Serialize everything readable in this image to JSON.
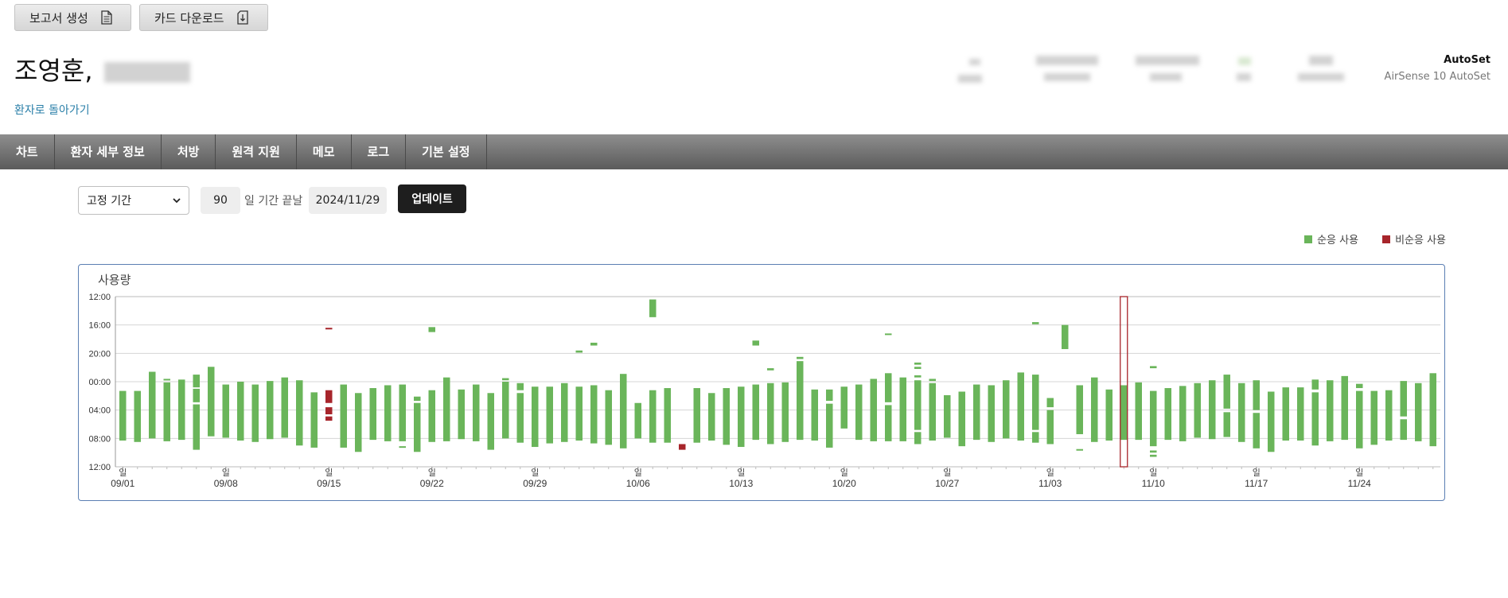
{
  "toolbar": {
    "report_label": "보고서 생성",
    "card_label": "카드 다운로드"
  },
  "patient": {
    "name": "조영훈,"
  },
  "back_link": "환자로 돌아가기",
  "device": {
    "mode": "AutoSet",
    "model": "AirSense 10 AutoSet"
  },
  "nav": {
    "items": [
      "차트",
      "환자 세부 정보",
      "처방",
      "원격 지원",
      "메모",
      "로그",
      "기본 설정"
    ]
  },
  "controls": {
    "period_type": "고정 기간",
    "days": "90",
    "label": "일 기간 끝날",
    "end_date": "2024/11/29",
    "update_label": "업데이트"
  },
  "legend": {
    "compliant": "순응 사용",
    "noncompliant": "비순응 사용"
  },
  "colors": {
    "compliant": "#6ab55a",
    "noncompliant": "#a7252b",
    "highlight": "#a7252b"
  },
  "chart_data": {
    "type": "bar",
    "title": "사용량",
    "y_ticks": [
      "12:00",
      "16:00",
      "20:00",
      "00:00",
      "04:00",
      "08:00",
      "12:00"
    ],
    "y_axis": "hours since 12:00 noon, range [0, 24]",
    "week_label": "일",
    "x_ticks": [
      "09/01",
      "09/08",
      "09/15",
      "09/22",
      "09/29",
      "10/06",
      "10/13",
      "10/20",
      "10/27",
      "11/03",
      "11/10",
      "11/17",
      "11/24"
    ],
    "start_date": "2024-09-01",
    "end_date": "2024-11-29",
    "highlight_date": "2024-11-08",
    "series": [
      {
        "date": "09-01",
        "segments": [
          [
            13.3,
            20.3,
            "c"
          ]
        ]
      },
      {
        "date": "09-02",
        "segments": [
          [
            13.3,
            20.5,
            "c"
          ]
        ]
      },
      {
        "date": "09-03",
        "segments": [
          [
            10.6,
            20.0,
            "c"
          ]
        ]
      },
      {
        "date": "09-04",
        "segments": [
          [
            11.6,
            11.8,
            "c"
          ],
          [
            12.1,
            20.4,
            "c"
          ]
        ]
      },
      {
        "date": "09-05",
        "segments": [
          [
            11.7,
            20.2,
            "c"
          ]
        ]
      },
      {
        "date": "09-06",
        "segments": [
          [
            11.0,
            12.8,
            "c"
          ],
          [
            13.0,
            14.9,
            "c"
          ],
          [
            15.2,
            21.6,
            "c"
          ]
        ]
      },
      {
        "date": "09-07",
        "segments": [
          [
            9.9,
            19.7,
            "c"
          ]
        ]
      },
      {
        "date": "09-08",
        "segments": [
          [
            12.4,
            19.9,
            "c"
          ]
        ]
      },
      {
        "date": "09-09",
        "segments": [
          [
            12.0,
            20.3,
            "c"
          ]
        ]
      },
      {
        "date": "09-10",
        "segments": [
          [
            12.4,
            20.5,
            "c"
          ]
        ]
      },
      {
        "date": "09-11",
        "segments": [
          [
            11.9,
            20.1,
            "c"
          ]
        ]
      },
      {
        "date": "09-12",
        "segments": [
          [
            11.4,
            19.9,
            "c"
          ]
        ]
      },
      {
        "date": "09-13",
        "segments": [
          [
            11.8,
            21.0,
            "c"
          ]
        ]
      },
      {
        "date": "09-14",
        "segments": [
          [
            13.5,
            21.3,
            "c"
          ]
        ]
      },
      {
        "date": "09-15",
        "segments": [
          [
            4.4,
            4.6,
            "n"
          ],
          [
            13.2,
            15.0,
            "n"
          ],
          [
            15.6,
            16.6,
            "n"
          ],
          [
            16.9,
            17.5,
            "n"
          ]
        ]
      },
      {
        "date": "09-16",
        "segments": [
          [
            12.4,
            21.3,
            "c"
          ]
        ]
      },
      {
        "date": "09-17",
        "segments": [
          [
            13.6,
            21.9,
            "c"
          ]
        ]
      },
      {
        "date": "09-18",
        "segments": [
          [
            12.9,
            20.2,
            "c"
          ]
        ]
      },
      {
        "date": "09-19",
        "segments": [
          [
            12.5,
            20.4,
            "c"
          ]
        ]
      },
      {
        "date": "09-20",
        "segments": [
          [
            12.4,
            20.4,
            "c"
          ],
          [
            21.1,
            21.3,
            "c"
          ]
        ]
      },
      {
        "date": "09-21",
        "segments": [
          [
            14.1,
            14.7,
            "c"
          ],
          [
            15.0,
            21.9,
            "c"
          ]
        ]
      },
      {
        "date": "09-22",
        "segments": [
          [
            4.3,
            5.0,
            "c"
          ],
          [
            13.2,
            20.5,
            "c"
          ]
        ]
      },
      {
        "date": "09-23",
        "segments": [
          [
            11.4,
            20.4,
            "c"
          ]
        ]
      },
      {
        "date": "09-24",
        "segments": [
          [
            13.1,
            20.1,
            "c"
          ]
        ]
      },
      {
        "date": "09-25",
        "segments": [
          [
            12.4,
            20.4,
            "c"
          ]
        ]
      },
      {
        "date": "09-26",
        "segments": [
          [
            13.6,
            21.6,
            "c"
          ]
        ]
      },
      {
        "date": "09-27",
        "segments": [
          [
            11.5,
            11.8,
            "c"
          ],
          [
            12.0,
            20.0,
            "c"
          ]
        ]
      },
      {
        "date": "09-28",
        "segments": [
          [
            12.2,
            13.2,
            "c"
          ],
          [
            13.6,
            20.6,
            "c"
          ]
        ]
      },
      {
        "date": "09-29",
        "segments": [
          [
            12.7,
            21.2,
            "c"
          ]
        ]
      },
      {
        "date": "09-30",
        "segments": [
          [
            12.7,
            20.7,
            "c"
          ]
        ]
      },
      {
        "date": "10-01",
        "segments": [
          [
            12.2,
            20.5,
            "c"
          ]
        ]
      },
      {
        "date": "10-02",
        "segments": [
          [
            7.6,
            7.9,
            "c"
          ],
          [
            12.7,
            20.3,
            "c"
          ]
        ]
      },
      {
        "date": "10-03",
        "segments": [
          [
            6.5,
            6.9,
            "c"
          ],
          [
            12.5,
            20.7,
            "c"
          ]
        ]
      },
      {
        "date": "10-04",
        "segments": [
          [
            13.2,
            20.9,
            "c"
          ]
        ]
      },
      {
        "date": "10-05",
        "segments": [
          [
            10.9,
            21.4,
            "c"
          ]
        ]
      },
      {
        "date": "10-06",
        "segments": [
          [
            15.0,
            20.0,
            "c"
          ]
        ]
      },
      {
        "date": "10-07",
        "segments": [
          [
            0.4,
            2.9,
            "c"
          ],
          [
            13.2,
            20.6,
            "c"
          ]
        ]
      },
      {
        "date": "10-08",
        "segments": [
          [
            12.9,
            20.6,
            "c"
          ]
        ]
      },
      {
        "date": "10-09",
        "segments": [
          [
            20.8,
            21.6,
            "n"
          ]
        ]
      },
      {
        "date": "10-10",
        "segments": [
          [
            12.9,
            20.6,
            "c"
          ]
        ]
      },
      {
        "date": "10-11",
        "segments": [
          [
            13.6,
            20.3,
            "c"
          ]
        ]
      },
      {
        "date": "10-12",
        "segments": [
          [
            12.9,
            20.9,
            "c"
          ]
        ]
      },
      {
        "date": "10-13",
        "segments": [
          [
            12.7,
            21.2,
            "c"
          ]
        ]
      },
      {
        "date": "10-14",
        "segments": [
          [
            6.2,
            6.9,
            "c"
          ],
          [
            12.4,
            20.2,
            "c"
          ]
        ]
      },
      {
        "date": "10-15",
        "segments": [
          [
            10.1,
            10.4,
            "c"
          ],
          [
            12.2,
            20.8,
            "c"
          ]
        ]
      },
      {
        "date": "10-16",
        "segments": [
          [
            12.1,
            20.5,
            "c"
          ]
        ]
      },
      {
        "date": "10-17",
        "segments": [
          [
            8.5,
            8.8,
            "c"
          ],
          [
            9.1,
            20.2,
            "c"
          ]
        ]
      },
      {
        "date": "10-18",
        "segments": [
          [
            13.1,
            20.3,
            "c"
          ]
        ]
      },
      {
        "date": "10-19",
        "segments": [
          [
            13.1,
            14.7,
            "c"
          ],
          [
            15.1,
            21.3,
            "c"
          ]
        ]
      },
      {
        "date": "10-20",
        "segments": [
          [
            12.7,
            18.6,
            "c"
          ]
        ]
      },
      {
        "date": "10-21",
        "segments": [
          [
            12.4,
            20.2,
            "c"
          ]
        ]
      },
      {
        "date": "10-22",
        "segments": [
          [
            11.6,
            20.4,
            "c"
          ]
        ]
      },
      {
        "date": "10-23",
        "segments": [
          [
            5.2,
            5.4,
            "c"
          ],
          [
            10.8,
            14.9,
            "c"
          ],
          [
            15.3,
            20.4,
            "c"
          ]
        ]
      },
      {
        "date": "10-24",
        "segments": [
          [
            11.4,
            20.4,
            "c"
          ]
        ]
      },
      {
        "date": "10-25",
        "segments": [
          [
            9.3,
            9.6,
            "c"
          ],
          [
            9.9,
            10.2,
            "c"
          ],
          [
            11.1,
            11.4,
            "c"
          ],
          [
            11.8,
            18.8,
            "c"
          ],
          [
            19.1,
            20.8,
            "c"
          ]
        ]
      },
      {
        "date": "10-26",
        "segments": [
          [
            11.6,
            11.9,
            "c"
          ],
          [
            12.2,
            20.3,
            "c"
          ]
        ]
      },
      {
        "date": "10-27",
        "segments": [
          [
            13.9,
            19.9,
            "c"
          ]
        ]
      },
      {
        "date": "10-28",
        "segments": [
          [
            13.4,
            21.1,
            "c"
          ]
        ]
      },
      {
        "date": "10-29",
        "segments": [
          [
            12.4,
            20.2,
            "c"
          ]
        ]
      },
      {
        "date": "10-30",
        "segments": [
          [
            12.5,
            20.5,
            "c"
          ]
        ]
      },
      {
        "date": "10-31",
        "segments": [
          [
            11.8,
            20.0,
            "c"
          ]
        ]
      },
      {
        "date": "11-01",
        "segments": [
          [
            10.7,
            20.3,
            "c"
          ]
        ]
      },
      {
        "date": "11-02",
        "segments": [
          [
            3.6,
            3.9,
            "c"
          ],
          [
            11.0,
            18.8,
            "c"
          ],
          [
            19.1,
            20.6,
            "c"
          ]
        ]
      },
      {
        "date": "11-03",
        "segments": [
          [
            14.3,
            15.6,
            "c"
          ],
          [
            16.0,
            20.8,
            "c"
          ]
        ]
      },
      {
        "date": "11-04",
        "segments": [
          [
            4.0,
            7.4,
            "c"
          ]
        ]
      },
      {
        "date": "11-05",
        "segments": [
          [
            12.5,
            19.4,
            "c"
          ],
          [
            21.5,
            21.7,
            "c"
          ]
        ]
      },
      {
        "date": "11-06",
        "segments": [
          [
            11.4,
            20.5,
            "c"
          ]
        ]
      },
      {
        "date": "11-07",
        "segments": [
          [
            13.1,
            20.3,
            "c"
          ]
        ]
      },
      {
        "date": "11-08",
        "segments": [
          [
            12.5,
            20.2,
            "c"
          ]
        ]
      },
      {
        "date": "11-09",
        "segments": [
          [
            12.1,
            20.2,
            "c"
          ]
        ]
      },
      {
        "date": "11-10",
        "segments": [
          [
            9.8,
            10.1,
            "c"
          ],
          [
            13.3,
            21.1,
            "c"
          ],
          [
            21.7,
            22.0,
            "c"
          ],
          [
            22.3,
            22.6,
            "c"
          ]
        ]
      },
      {
        "date": "11-11",
        "segments": [
          [
            12.9,
            20.2,
            "c"
          ]
        ]
      },
      {
        "date": "11-12",
        "segments": [
          [
            12.6,
            20.4,
            "c"
          ]
        ]
      },
      {
        "date": "11-13",
        "segments": [
          [
            12.2,
            19.9,
            "c"
          ]
        ]
      },
      {
        "date": "11-14",
        "segments": [
          [
            11.8,
            20.1,
            "c"
          ]
        ]
      },
      {
        "date": "11-15",
        "segments": [
          [
            11.0,
            15.8,
            "c"
          ],
          [
            16.3,
            19.8,
            "c"
          ]
        ]
      },
      {
        "date": "11-16",
        "segments": [
          [
            12.2,
            20.5,
            "c"
          ]
        ]
      },
      {
        "date": "11-17",
        "segments": [
          [
            11.8,
            16.0,
            "c"
          ],
          [
            16.4,
            21.4,
            "c"
          ]
        ]
      },
      {
        "date": "11-18",
        "segments": [
          [
            13.4,
            21.9,
            "c"
          ]
        ]
      },
      {
        "date": "11-19",
        "segments": [
          [
            12.8,
            20.3,
            "c"
          ]
        ]
      },
      {
        "date": "11-20",
        "segments": [
          [
            12.8,
            20.3,
            "c"
          ]
        ]
      },
      {
        "date": "11-21",
        "segments": [
          [
            11.7,
            13.1,
            "c"
          ],
          [
            13.5,
            21.0,
            "c"
          ]
        ]
      },
      {
        "date": "11-22",
        "segments": [
          [
            11.8,
            20.4,
            "c"
          ]
        ]
      },
      {
        "date": "11-23",
        "segments": [
          [
            11.2,
            20.2,
            "c"
          ]
        ]
      },
      {
        "date": "11-24",
        "segments": [
          [
            12.3,
            12.9,
            "c"
          ],
          [
            13.3,
            21.4,
            "c"
          ]
        ]
      },
      {
        "date": "11-25",
        "segments": [
          [
            13.3,
            20.9,
            "c"
          ]
        ]
      },
      {
        "date": "11-26",
        "segments": [
          [
            13.2,
            20.3,
            "c"
          ]
        ]
      },
      {
        "date": "11-27",
        "segments": [
          [
            11.9,
            16.9,
            "c"
          ],
          [
            17.3,
            20.2,
            "c"
          ]
        ]
      },
      {
        "date": "11-28",
        "segments": [
          [
            12.2,
            20.4,
            "c"
          ]
        ]
      },
      {
        "date": "11-29",
        "segments": [
          [
            10.8,
            21.1,
            "c"
          ]
        ]
      }
    ]
  }
}
